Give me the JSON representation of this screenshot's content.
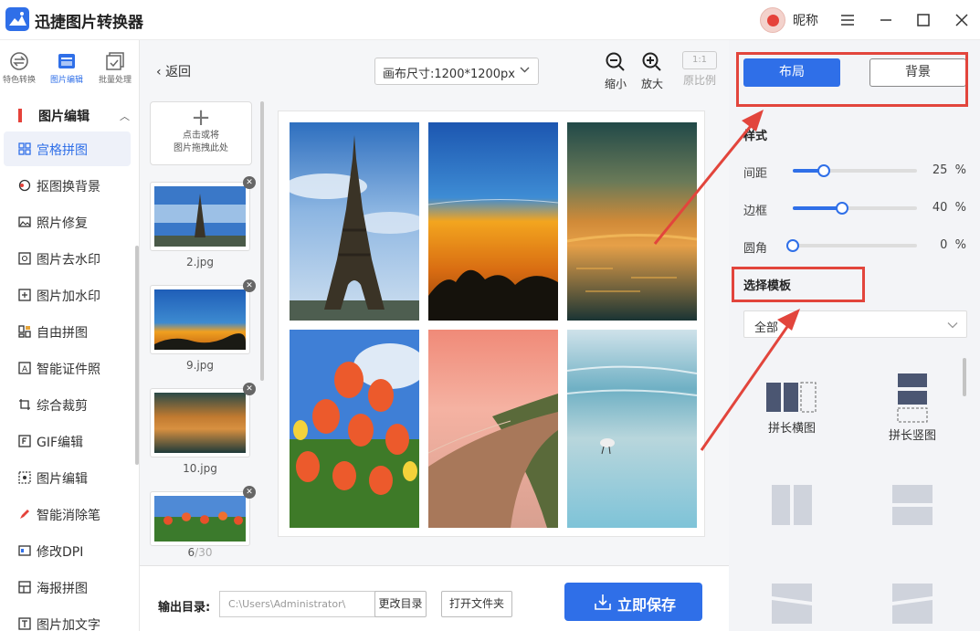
{
  "app": {
    "title": "迅捷图片转换器",
    "user_nickname": "昵称"
  },
  "sidebar": {
    "top_tabs": [
      {
        "label": "特色转换"
      },
      {
        "label": "图片编辑"
      },
      {
        "label": "批量处理"
      }
    ],
    "group": {
      "label": "图片编辑"
    },
    "items": [
      {
        "label": "宫格拼图"
      },
      {
        "label": "抠图换背景"
      },
      {
        "label": "照片修复"
      },
      {
        "label": "图片去水印"
      },
      {
        "label": "图片加水印"
      },
      {
        "label": "自由拼图"
      },
      {
        "label": "智能证件照"
      },
      {
        "label": "综合裁剪"
      },
      {
        "label": "GIF编辑"
      },
      {
        "label": "图片编辑"
      },
      {
        "label": "智能消除笔"
      },
      {
        "label": "修改DPI"
      },
      {
        "label": "海报拼图"
      },
      {
        "label": "图片加文字"
      }
    ]
  },
  "toolbar": {
    "back_label": "返回",
    "canvas_size": "画布尺寸:1200*1200px",
    "zoom_out": "缩小",
    "zoom_in": "放大",
    "ratio_badge": "1:1",
    "ratio_label": "原比例"
  },
  "image_list": {
    "upload_line1": "点击或将",
    "upload_line2": "图片拖拽此处",
    "files": [
      {
        "name": "2.jpg"
      },
      {
        "name": "9.jpg"
      },
      {
        "name": "10.jpg"
      },
      {
        "name": ""
      }
    ],
    "count_current": "6",
    "count_total": "/30"
  },
  "footer": {
    "output_label": "输出目录:",
    "output_path": "C:\\Users\\Administrator\\",
    "change_dir": "更改目录",
    "open_folder": "打开文件夹",
    "save": "立即保存"
  },
  "panel": {
    "tabs": [
      {
        "label": "布局"
      },
      {
        "label": "背景"
      }
    ],
    "style_title": "样式",
    "sliders": [
      {
        "label": "间距",
        "value": 25,
        "unit": "%"
      },
      {
        "label": "边框",
        "value": 40,
        "unit": "%"
      },
      {
        "label": "圆角",
        "value": 0,
        "unit": "%"
      }
    ],
    "template_title": "选择模板",
    "template_filter": "全部",
    "templates": [
      {
        "label": "拼长横图"
      },
      {
        "label": "拼长竖图"
      }
    ]
  },
  "colors": {
    "accent": "#2f6fe8",
    "highlight": "#e2453c"
  }
}
